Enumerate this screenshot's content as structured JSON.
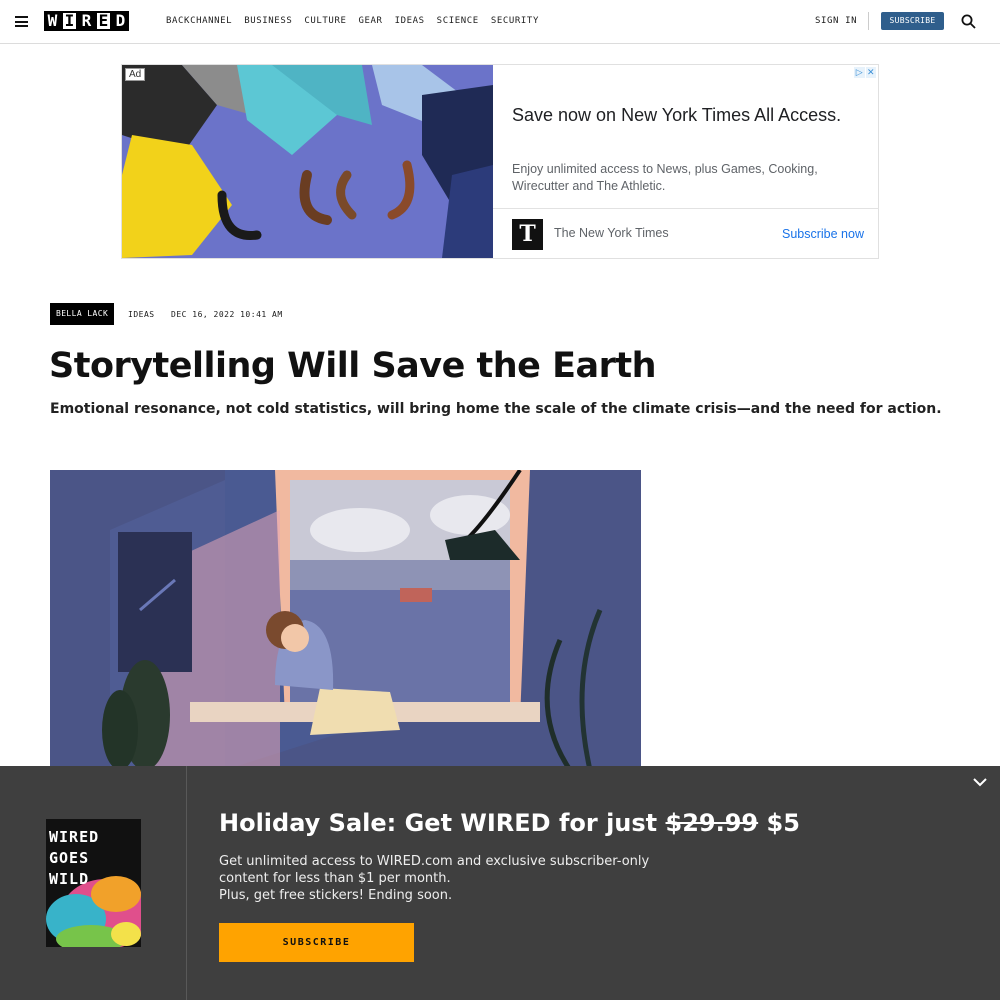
{
  "nav": {
    "links": [
      "BACKCHANNEL",
      "BUSINESS",
      "CULTURE",
      "GEAR",
      "IDEAS",
      "SCIENCE",
      "SECURITY"
    ],
    "sign_in": "SIGN IN",
    "subscribe": "SUBSCRIBE",
    "logo_letters": [
      "W",
      "I",
      "R",
      "E",
      "D"
    ]
  },
  "ad": {
    "badge": "Ad",
    "title": "Save now on New York Times All Access.",
    "body": "Enjoy unlimited access to News, plus Games, Cooking, Wirecutter and The Athletic.",
    "brand_logo": "T",
    "brand": "The New York Times",
    "cta": "Subscribe now"
  },
  "article": {
    "author": "BELLA LACK",
    "rubric": "IDEAS",
    "date": "DEC 16, 2022 10:41 AM",
    "headline": "Storytelling Will Save the Earth",
    "dek": "Emotional resonance, not cold statistics, will bring home the scale of the climate crisis—and the need for action."
  },
  "promo": {
    "cover_lines": [
      "WIRED",
      "GOES",
      "WILD"
    ],
    "title_prefix": "Holiday Sale: Get WIRED for just ",
    "old_price": "$29.99",
    "new_price": " $5",
    "body_lines": [
      "Get unlimited access to WIRED.com and exclusive subscriber-only",
      "content for less than $1 per month.",
      "Plus, get free stickers! Ending soon."
    ],
    "button": "SUBSCRIBE"
  },
  "colors": {
    "subscribe_blue": "#2f5e8c",
    "promo_bg": "#3f3f3f",
    "promo_button": "#ffa300",
    "ad_link": "#1a73e8"
  }
}
